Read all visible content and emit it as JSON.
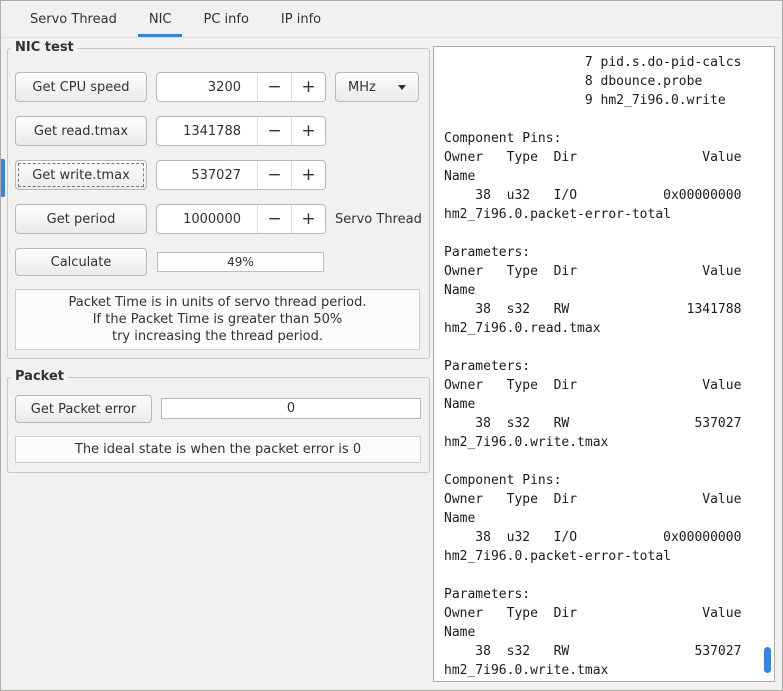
{
  "window": {
    "accent": "#3584e4",
    "bg": "#f2f1f0"
  },
  "tabs": [
    {
      "label": "Servo Thread",
      "active": false
    },
    {
      "label": "NIC",
      "active": true
    },
    {
      "label": "PC info",
      "active": false
    },
    {
      "label": "IP info",
      "active": false
    }
  ],
  "icons": {
    "minus": "−",
    "plus": "+"
  },
  "nic_test": {
    "frame_label": "NIC test",
    "rows": [
      {
        "button": "Get CPU speed",
        "value": "3200",
        "unit": "MHz"
      },
      {
        "button": "Get read.tmax",
        "value": "1341788"
      },
      {
        "button": "Get write.tmax",
        "value": "537027"
      },
      {
        "button": "Get period",
        "value": "1000000",
        "suffix": "Servo Thread"
      }
    ],
    "calculate_button": "Calculate",
    "progress": "49%",
    "note": "Packet Time is in units of servo thread period.\nIf the Packet Time is greater than 50%\ntry increasing the thread period."
  },
  "packet": {
    "frame_label": "Packet",
    "button": "Get Packet error",
    "value": "0",
    "note": "The ideal state is when the packet error is 0"
  },
  "console": {
    "text": "                  7 pid.s.do-pid-calcs\n                  8 dbounce.probe\n                  9 hm2_7i96.0.write\n\nComponent Pins:\nOwner   Type  Dir                Value\nName\n    38  u32   I/O           0x00000000\nhm2_7i96.0.packet-error-total\n\nParameters:\nOwner   Type  Dir                Value\nName\n    38  s32   RW               1341788\nhm2_7i96.0.read.tmax\n\nParameters:\nOwner   Type  Dir                Value\nName\n    38  s32   RW                537027\nhm2_7i96.0.write.tmax\n\nComponent Pins:\nOwner   Type  Dir                Value\nName\n    38  u32   I/O           0x00000000\nhm2_7i96.0.packet-error-total\n\nParameters:\nOwner   Type  Dir                Value\nName\n    38  s32   RW                537027\nhm2_7i96.0.write.tmax"
  }
}
